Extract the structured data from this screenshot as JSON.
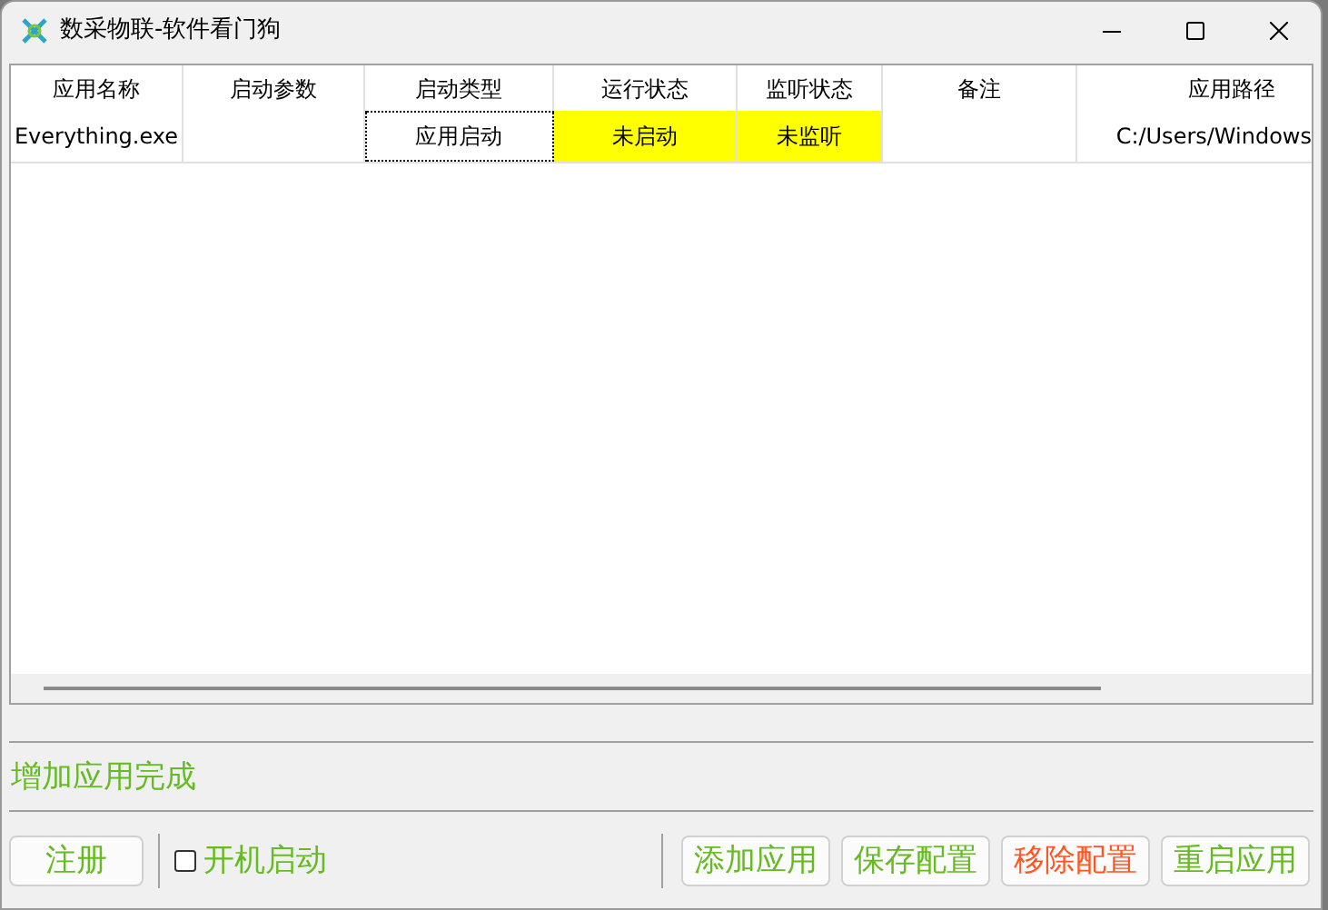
{
  "window": {
    "title": "数采物联-软件看门狗"
  },
  "table": {
    "columns": [
      "应用名称",
      "启动参数",
      "启动类型",
      "运行状态",
      "监听状态",
      "备注",
      "应用路径"
    ],
    "rows": [
      [
        {
          "text": "Everything.exe",
          "selected": false
        },
        {
          "text": "",
          "selected": false
        },
        {
          "text": "应用启动",
          "selected": true
        },
        {
          "text": "未启动",
          "selected": false,
          "color": "#ffff00"
        },
        {
          "text": "未监听",
          "selected": false,
          "color": "#ffff00"
        },
        {
          "text": "",
          "selected": false
        },
        {
          "text": "C:/Users/Windows",
          "selected": false
        }
      ]
    ]
  },
  "status_message": "增加应用完成",
  "register_button": "注册",
  "autostart": {
    "label": "开机启动",
    "checked": false
  },
  "buttons": [
    {
      "label": "添加应用",
      "color": "#66bb22"
    },
    {
      "label": "保存配置",
      "color": "#66bb22"
    },
    {
      "label": "移除配置",
      "color": "#ff5522"
    },
    {
      "label": "重启应用",
      "color": "#66bb22"
    }
  ]
}
